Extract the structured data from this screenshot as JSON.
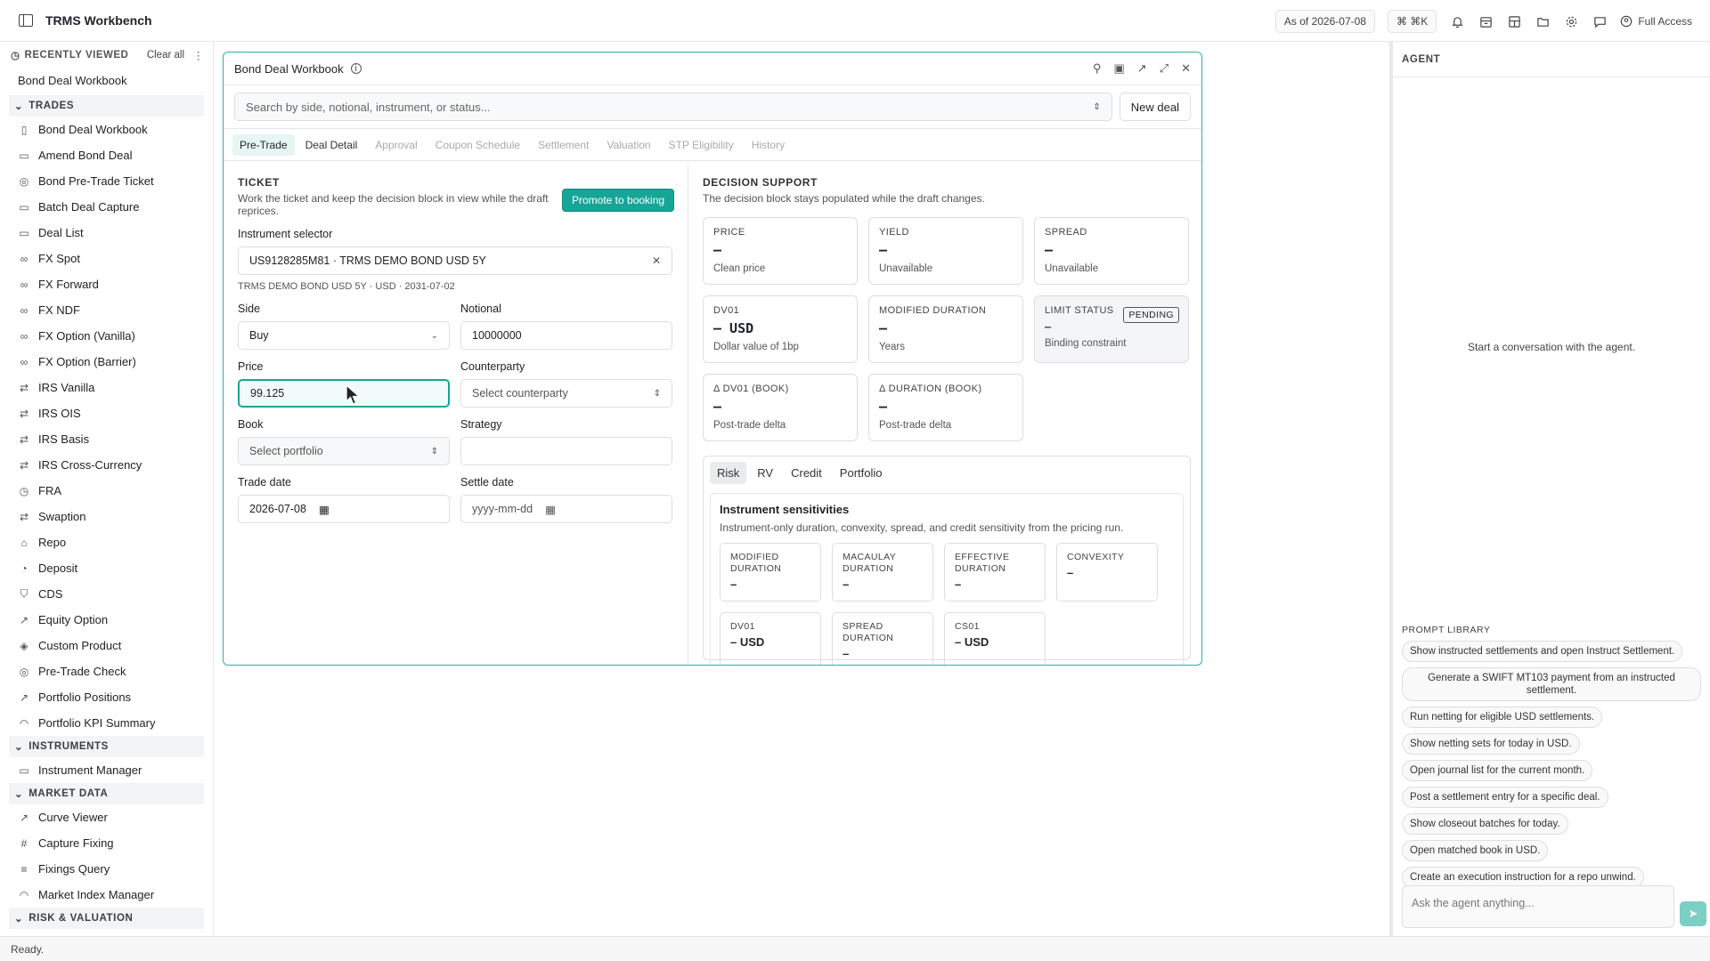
{
  "app": {
    "title": "TRMS Workbench",
    "as_of": "As of 2026-07-08",
    "shortcut": "⌘ ⌘K",
    "access": "Full Access",
    "status": "Ready."
  },
  "sidebar": {
    "recent_label": "RECENTLY VIEWED",
    "clear_label": "Clear all",
    "recent_items": [
      "Bond Deal Workbook"
    ],
    "sections": [
      {
        "label": "TRADES",
        "items": [
          {
            "label": "Bond Deal Workbook",
            "icon": "book-icon"
          },
          {
            "label": "Amend Bond Deal",
            "icon": "file-icon"
          },
          {
            "label": "Bond Pre-Trade Ticket",
            "icon": "check-icon"
          },
          {
            "label": "Batch Deal Capture",
            "icon": "file-icon"
          },
          {
            "label": "Deal List",
            "icon": "file-icon"
          },
          {
            "label": "FX Spot",
            "icon": "link-icon"
          },
          {
            "label": "FX Forward",
            "icon": "link-icon"
          },
          {
            "label": "FX NDF",
            "icon": "link-icon"
          },
          {
            "label": "FX Option (Vanilla)",
            "icon": "link-icon"
          },
          {
            "label": "FX Option (Barrier)",
            "icon": "link-icon"
          },
          {
            "label": "IRS Vanilla",
            "icon": "swap-icon"
          },
          {
            "label": "IRS OIS",
            "icon": "swap-icon"
          },
          {
            "label": "IRS Basis",
            "icon": "swap-icon"
          },
          {
            "label": "IRS Cross-Currency",
            "icon": "swap-icon"
          },
          {
            "label": "FRA",
            "icon": "clock-icon"
          },
          {
            "label": "Swaption",
            "icon": "swap-icon"
          },
          {
            "label": "Repo",
            "icon": "bank-icon"
          },
          {
            "label": "Deposit",
            "icon": "piggy-icon"
          },
          {
            "label": "CDS",
            "icon": "shield-icon"
          },
          {
            "label": "Equity Option",
            "icon": "chart-icon"
          },
          {
            "label": "Custom Product",
            "icon": "box-icon"
          },
          {
            "label": "Pre-Trade Check",
            "icon": "check-icon"
          },
          {
            "label": "Portfolio Positions",
            "icon": "trend-icon"
          },
          {
            "label": "Portfolio KPI Summary",
            "icon": "gauge-icon"
          }
        ]
      },
      {
        "label": "INSTRUMENTS",
        "items": [
          {
            "label": "Instrument Manager",
            "icon": "file-icon"
          }
        ]
      },
      {
        "label": "MARKET DATA",
        "items": [
          {
            "label": "Curve Viewer",
            "icon": "chart-icon"
          },
          {
            "label": "Capture Fixing",
            "icon": "hash-icon"
          },
          {
            "label": "Fixings Query",
            "icon": "db-icon"
          },
          {
            "label": "Market Index Manager",
            "icon": "gauge-icon"
          }
        ]
      },
      {
        "label": "RISK & VALUATION",
        "items": []
      }
    ]
  },
  "panel": {
    "title": "Bond Deal Workbook",
    "search_placeholder": "Search by side, notional, instrument, or status...",
    "new_deal": "New deal",
    "tabs": [
      {
        "label": "Pre-Trade",
        "state": "active"
      },
      {
        "label": "Deal Detail",
        "state": "enabled"
      },
      {
        "label": "Approval",
        "state": "disabled"
      },
      {
        "label": "Coupon Schedule",
        "state": "disabled"
      },
      {
        "label": "Settlement",
        "state": "disabled"
      },
      {
        "label": "Valuation",
        "state": "disabled"
      },
      {
        "label": "STP Eligibility",
        "state": "disabled"
      },
      {
        "label": "History",
        "state": "disabled"
      }
    ],
    "ticket": {
      "heading": "TICKET",
      "desc": "Work the ticket and keep the decision block in view while the draft reprices.",
      "promote": "Promote to booking",
      "instrument_label": "Instrument selector",
      "instrument_value": "US9128285M81 · TRMS DEMO BOND USD 5Y",
      "instrument_meta": "TRMS DEMO BOND USD 5Y · USD · 2031-07-02",
      "side_label": "Side",
      "side_value": "Buy",
      "notional_label": "Notional",
      "notional_value": "10000000",
      "price_label": "Price",
      "price_value": "99.125",
      "counterparty_label": "Counterparty",
      "counterparty_placeholder": "Select counterparty",
      "book_label": "Book",
      "book_placeholder": "Select portfolio",
      "strategy_label": "Strategy",
      "strategy_value": "",
      "trade_date_label": "Trade date",
      "trade_date_value": "2026-07-08",
      "settle_date_label": "Settle date",
      "settle_date_placeholder": "yyyy-mm-dd"
    },
    "decision": {
      "heading": "DECISION SUPPORT",
      "desc": "The decision block stays populated while the draft changes.",
      "cards": [
        {
          "label": "PRICE",
          "value": "—",
          "sub": "Clean price"
        },
        {
          "label": "YIELD",
          "value": "—",
          "sub": "Unavailable"
        },
        {
          "label": "SPREAD",
          "value": "—",
          "sub": "Unavailable"
        },
        {
          "label": "DV01",
          "value": "— USD",
          "sub": "Dollar value of 1bp"
        },
        {
          "label": "MODIFIED DURATION",
          "value": "—",
          "sub": "Years"
        },
        {
          "label": "LIMIT STATUS",
          "value": "—",
          "sub": "Binding constraint",
          "badge": "PENDING"
        },
        {
          "label": "Δ DV01 (BOOK)",
          "value": "—",
          "sub": "Post-trade delta"
        },
        {
          "label": "Δ DURATION (BOOK)",
          "value": "—",
          "sub": "Post-trade delta"
        }
      ],
      "subtabs": [
        "Risk",
        "RV",
        "Credit",
        "Portfolio"
      ],
      "sens_title": "Instrument sensitivities",
      "sens_desc": "Instrument-only duration, convexity, spread, and credit sensitivity from the pricing run.",
      "sens": [
        {
          "label": "MODIFIED DURATION",
          "value": "–"
        },
        {
          "label": "MACAULAY DURATION",
          "value": "–"
        },
        {
          "label": "EFFECTIVE DURATION",
          "value": "–"
        },
        {
          "label": "CONVEXITY",
          "value": "–"
        },
        {
          "label": "DV01",
          "value": "– USD"
        },
        {
          "label": "SPREAD DURATION",
          "value": "–"
        },
        {
          "label": "CS01",
          "value": "– USD"
        }
      ]
    }
  },
  "agent": {
    "title": "AGENT",
    "empty": "Start a conversation with the agent.",
    "library_label": "PROMPT LIBRARY",
    "prompts": [
      "Show instructed settlements and open Instruct Settlement.",
      "Generate a SWIFT MT103 payment from an instructed settlement.",
      "Run netting for eligible USD settlements.",
      "Show netting sets for today in USD.",
      "Open journal list for the current month.",
      "Post a settlement entry for a specific deal.",
      "Show closeout batches for today.",
      "Open matched book in USD.",
      "Create an execution instruction for a repo unwind."
    ],
    "input_placeholder": "Ask the agent anything..."
  },
  "colors": {
    "accent": "#17a597"
  }
}
